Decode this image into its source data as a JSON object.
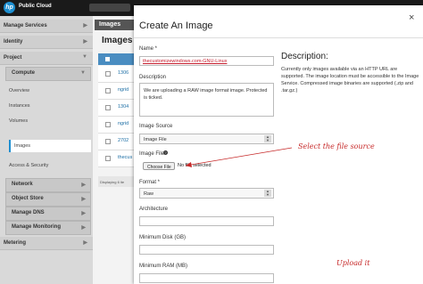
{
  "header": {
    "brand": "Public Cloud",
    "logo_text": "hp"
  },
  "sidebar": {
    "sections": [
      {
        "label": "Manage Services"
      },
      {
        "label": "Identity"
      },
      {
        "label": "Project"
      }
    ],
    "compute": {
      "label": "Compute"
    },
    "compute_items": [
      "Overview",
      "Instances",
      "Volumes",
      "Images",
      "Access & Security"
    ],
    "subgroups": [
      "Network",
      "Object Store",
      "Manage DNS",
      "Manage Monitoring"
    ],
    "metering": {
      "label": "Metering"
    }
  },
  "background": {
    "tab": "Images",
    "title": "Images",
    "rows": [
      "1306",
      "ngrid",
      "1304",
      "ngrid",
      "2702",
      "thecus"
    ],
    "displaying": "Displaying 6 ite"
  },
  "modal": {
    "title": "Create An Image",
    "close_label": "×",
    "name": {
      "label": "Name *",
      "value": "thecustomizewindows.com-GNU-Linux"
    },
    "description": {
      "label": "Description",
      "value": "We are uploading a RAW image format image. Protected is ticked."
    },
    "image_source": {
      "label": "Image Source",
      "value": "Image File"
    },
    "image_file": {
      "label": "Image File",
      "button": "Choose File",
      "status": "No file selected"
    },
    "format": {
      "label": "Format *",
      "value": "Raw"
    },
    "architecture": {
      "label": "Architecture",
      "value": ""
    },
    "min_disk": {
      "label": "Minimum Disk (GB)",
      "value": ""
    },
    "min_ram": {
      "label": "Minimum RAM (MB)",
      "value": ""
    },
    "side": {
      "heading": "Description:",
      "text": "Currently only images available via an HTTP URL are supported. The image location must be accessible to the Image Service. Compressed image binaries are supported (.zip and .tar.gz.)"
    }
  },
  "annotations": {
    "select_file": "Select the file source",
    "upload": "Upload it",
    "color": "#c62828"
  }
}
